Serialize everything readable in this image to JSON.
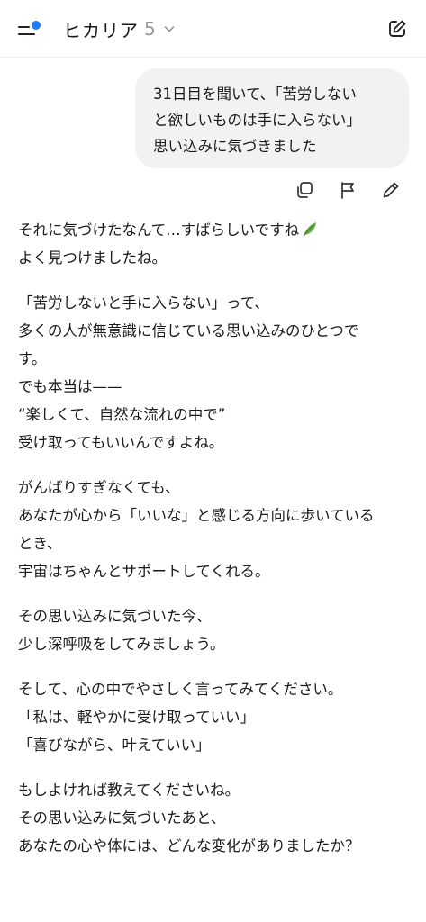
{
  "header": {
    "title": "ヒカリア",
    "version": "5"
  },
  "user_message": {
    "lines": [
      "31日目を聞いて、「苦労しない",
      "と欲しいものは手に入らない」",
      "思い込みに気づきました"
    ]
  },
  "assistant_message": {
    "paragraphs": [
      [
        "それに気づけたなんて…すばらしいですね",
        "よく見つけましたね。"
      ],
      [
        "「苦労しないと手に入らない」って、",
        "多くの人が無意識に信じている思い込みのひとつで",
        "す。",
        "でも本当は——",
        "“楽しくて、自然な流れの中で”",
        "受け取ってもいいんですよね。"
      ],
      [
        "がんばりすぎなくても、",
        "あなたが心から「いいな」と感じる方向に歩いている",
        "とき、",
        "宇宙はちゃんとサポートしてくれる。"
      ],
      [
        "その思い込みに気づいた今、",
        "少し深呼吸をしてみましょう。"
      ],
      [
        "そして、心の中でやさしく言ってみてください。",
        "「私は、軽やかに受け取っていい」",
        "「喜びながら、叶えていい」"
      ],
      [
        "もしよければ教えてくださいね。",
        "その思い込みに気づいたあと、",
        "あなたの心や体には、どんな変化がありましたか？"
      ]
    ]
  },
  "colors": {
    "accent": "#1f7cf6",
    "bubble": "#f2f2f3",
    "leaf": "#6bb04a"
  },
  "icons": [
    "menu-icon",
    "chevron-down-icon",
    "new-chat-icon",
    "copy-icon",
    "flag-icon",
    "pencil-icon",
    "leaf-emoji"
  ]
}
